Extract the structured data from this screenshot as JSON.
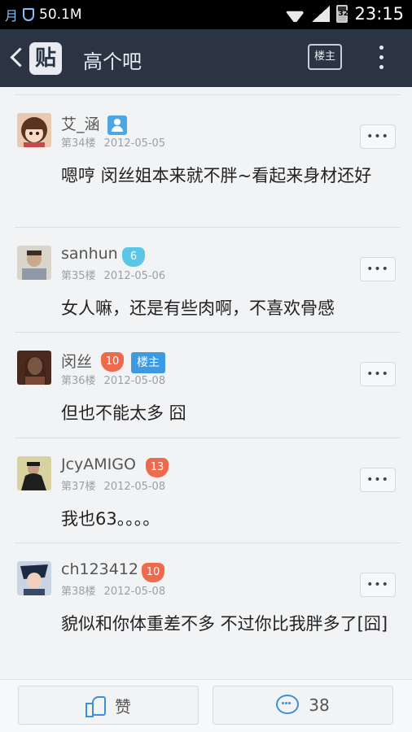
{
  "status_bar": {
    "carrier_glyph": "月",
    "speed": "50.1M",
    "battery": "32",
    "time": "23:15"
  },
  "header": {
    "logo": "贴",
    "title": "高个吧",
    "louzhu_toggle": "楼主"
  },
  "posts": [
    {
      "username": "艾_涵",
      "floor": "第34楼",
      "date": "2012-05-05",
      "content": "嗯哼 闵丝姐本来就不胖~看起来身材还好",
      "level": null,
      "is_louzhu": false,
      "avatar_color": "#8a5a3a"
    },
    {
      "username": "sanhun",
      "floor": "第35楼",
      "date": "2012-05-06",
      "content": "女人嘛，还是有些肉啊，不喜欢骨感",
      "level": "6",
      "level_color": "#5cc6e6",
      "is_louzhu": false,
      "avatar_color": "#a89a8c"
    },
    {
      "username": "闵丝",
      "floor": "第36楼",
      "date": "2012-05-08",
      "content": "但也不能太多 囧",
      "level": "10",
      "level_color": "#ef6a4c",
      "is_louzhu": true,
      "louzhu_label": "楼主",
      "avatar_color": "#6b3d2a"
    },
    {
      "username": "JcyAMIGO",
      "floor": "第37楼",
      "date": "2012-05-08",
      "content": "我也63。。。。",
      "level": "13",
      "level_color": "#ef6a4c",
      "is_louzhu": false,
      "avatar_color": "#2a2a2a"
    },
    {
      "username": "ch123412",
      "floor": "第38楼",
      "date": "2012-05-08",
      "content": "貌似和你体重差不多 不过你比我胖多了[囧]",
      "level": "10",
      "level_color": "#ef6a4c",
      "is_louzhu": false,
      "avatar_color": "#3a4a66"
    }
  ],
  "more_glyph": "•••",
  "bottom_bar": {
    "like_label": "赞",
    "comment_count": "38"
  }
}
